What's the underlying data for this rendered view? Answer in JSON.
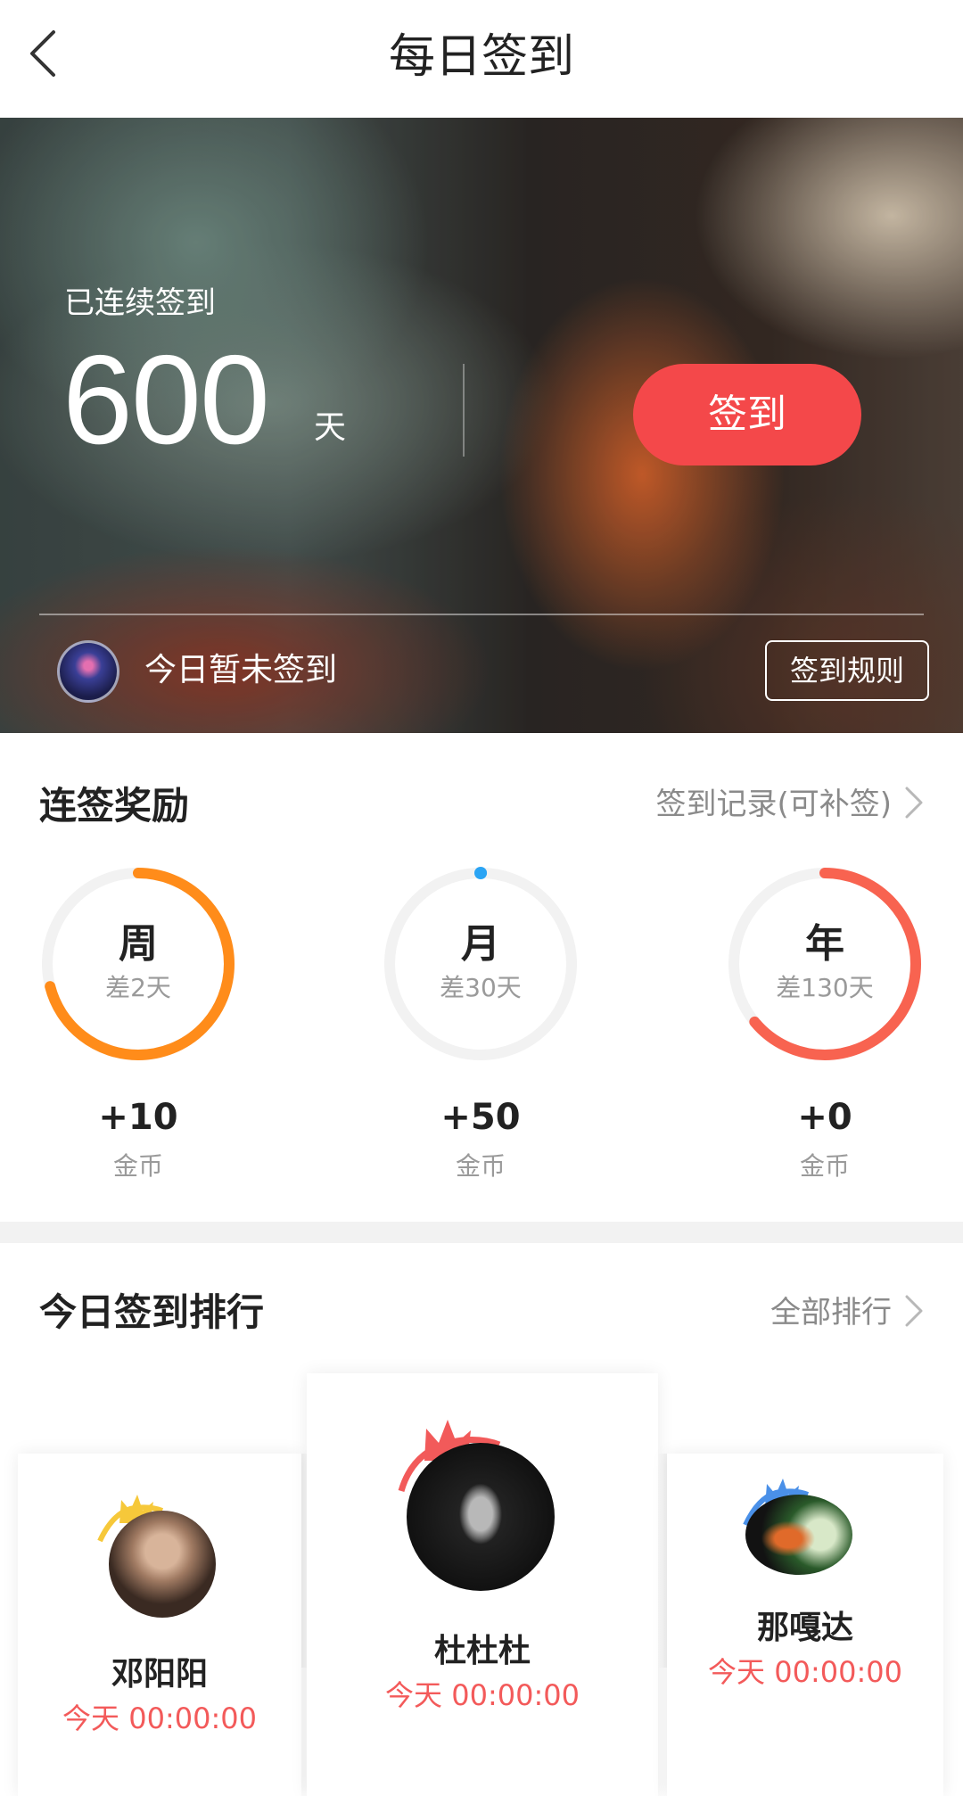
{
  "header": {
    "title": "每日签到",
    "back_icon": "chevron-left-icon"
  },
  "hero": {
    "streak_label": "已连续签到",
    "streak_days": "600",
    "streak_unit": "天",
    "signin_button": "签到",
    "status": "今日暂未签到",
    "rules_button": "签到规则",
    "accent_color": "#f4484a"
  },
  "rewards": {
    "title": "连签奖励",
    "history_link": "签到记录(可补签)",
    "items": [
      {
        "period": "周",
        "remaining": "差2天",
        "amount": "+10",
        "unit": "金币",
        "progress": 0.71,
        "color": "#ff8c1a"
      },
      {
        "period": "月",
        "remaining": "差30天",
        "amount": "+50",
        "unit": "金币",
        "progress": 0.0,
        "color": "#2aa4f4"
      },
      {
        "period": "年",
        "remaining": "差130天",
        "amount": "+0",
        "unit": "金币",
        "progress": 0.64,
        "color": "#f86350"
      }
    ]
  },
  "ranking": {
    "title": "今日签到排行",
    "all_link": "全部排行",
    "entries": [
      {
        "rank": 2,
        "name": "邓阳阳",
        "time": "今天 00:00:00",
        "crown_color": "#f6c83a"
      },
      {
        "rank": 1,
        "name": "杜杜杜",
        "time": "今天 00:00:00",
        "crown_color": "#f25a5a"
      },
      {
        "rank": 3,
        "name": "那嘎达",
        "time": "今天 00:00:00",
        "crown_color": "#4a90e8"
      }
    ]
  }
}
